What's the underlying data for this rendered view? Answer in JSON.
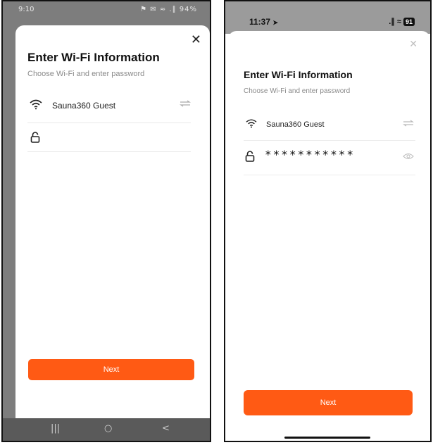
{
  "android": {
    "status": {
      "time": "9:10",
      "icons": "⚑ ✉ ≈ .∥ 94%"
    },
    "sheet": {
      "close": "✕",
      "title": "Enter Wi-Fi Information",
      "subtitle": "Choose Wi-Fi and enter password",
      "wifi_name": "Sauna360 Guest",
      "password_value": "",
      "password_placeholder": "",
      "next_label": "Next"
    },
    "nav": {
      "recents": "|||",
      "home": "○",
      "back": "<"
    }
  },
  "ios": {
    "status": {
      "time": "11:37",
      "location": "➤",
      "signal": ".∥",
      "wifi": "≈",
      "battery": "91"
    },
    "sheet": {
      "close": "✕",
      "title": "Enter Wi-Fi Information",
      "subtitle": "Choose Wi-Fi and enter password",
      "wifi_name": "Sauna360 Guest",
      "password_masked": "***********",
      "next_label": "Next"
    }
  },
  "colors": {
    "accent": "#ff5a14",
    "android_frame": "#7d7d7d",
    "android_nav": "#5a5a5a",
    "ios_status": "#9b9b9b"
  },
  "icons": [
    "wifi-icon",
    "lock-icon",
    "swap-icon",
    "eye-icon",
    "close-icon",
    "location-arrow-icon"
  ]
}
